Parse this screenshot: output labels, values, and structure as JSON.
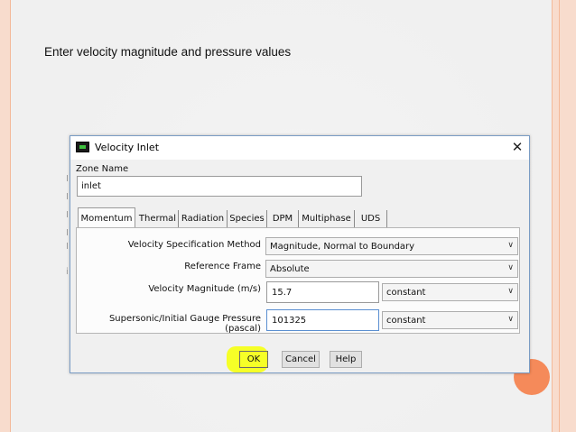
{
  "slide": {
    "instruction": "Enter velocity magnitude and pressure values",
    "bg_glyphs": [
      "I",
      "I",
      "I",
      "I",
      "I",
      "i"
    ]
  },
  "dialog": {
    "title": "Velocity Inlet",
    "close_glyph": "✕",
    "zone_name_label": "Zone Name",
    "zone_name_value": "inlet",
    "tabs": [
      "Momentum",
      "Thermal",
      "Radiation",
      "Species",
      "DPM",
      "Multiphase",
      "UDS"
    ],
    "active_tab": "Momentum",
    "fields": {
      "velocity_spec_method": {
        "label": "Velocity Specification Method",
        "value": "Magnitude, Normal to Boundary"
      },
      "reference_frame": {
        "label": "Reference Frame",
        "value": "Absolute"
      },
      "velocity_magnitude": {
        "label": "Velocity Magnitude (m/s)",
        "value": "15.7",
        "option": "constant"
      },
      "gauge_pressure": {
        "label": "Supersonic/Initial Gauge Pressure (pascal)",
        "value": "101325",
        "option": "constant"
      }
    },
    "buttons": {
      "ok": "OK",
      "cancel": "Cancel",
      "help": "Help"
    }
  },
  "icons": {
    "chevron": "chevron-down-icon",
    "app": "fluent-app-icon",
    "close": "close-icon"
  },
  "colors": {
    "slide_border": "#f8dccd",
    "accent_dot": "#f58a5a",
    "ok_highlight": "#f6ff27",
    "dialog_border": "#7a9cc4"
  }
}
